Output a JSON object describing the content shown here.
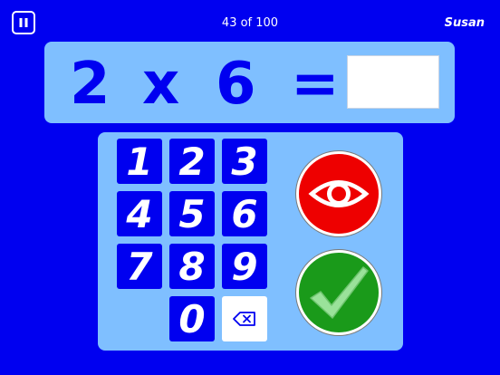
{
  "header": {
    "progress_text": "43 of 100",
    "user_name": "Susan"
  },
  "equation": {
    "operand_a": "2",
    "operator": "x",
    "operand_b": "6",
    "equals": "=",
    "answer_value": ""
  },
  "keypad": {
    "keys": [
      "1",
      "2",
      "3",
      "4",
      "5",
      "6",
      "7",
      "8",
      "9",
      "0"
    ]
  },
  "icons": {
    "pause": "pause-icon",
    "backspace": "backspace-icon",
    "peek": "eye-icon",
    "submit": "checkmark-icon"
  },
  "colors": {
    "background": "#0000f0",
    "panel": "#7fbfff",
    "peek_button": "#ee0000",
    "submit_button": "#1a9a1a",
    "check_mark": "#9ae29a"
  }
}
